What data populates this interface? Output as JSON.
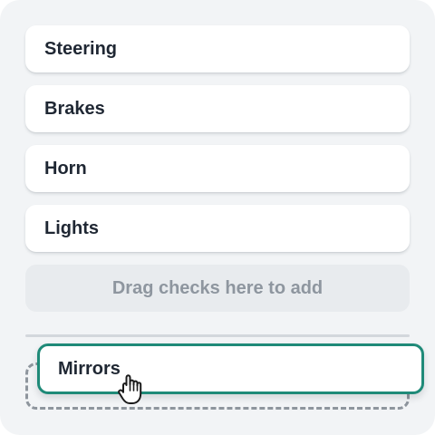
{
  "checklist": {
    "items": [
      {
        "label": "Steering"
      },
      {
        "label": "Brakes"
      },
      {
        "label": "Horn"
      },
      {
        "label": "Lights"
      }
    ],
    "drop_hint": "Drag checks here to add"
  },
  "dragging": {
    "label": "Mirrors"
  },
  "icons": {
    "cursor": "grab-hand-cursor-icon"
  },
  "colors": {
    "panel_background": "#f2f4f6",
    "card_background": "#ffffff",
    "drag_accent": "#1f8a78",
    "text_primary": "#1f2733",
    "text_muted": "#8e969f",
    "dashed_outline": "#8e959d"
  }
}
